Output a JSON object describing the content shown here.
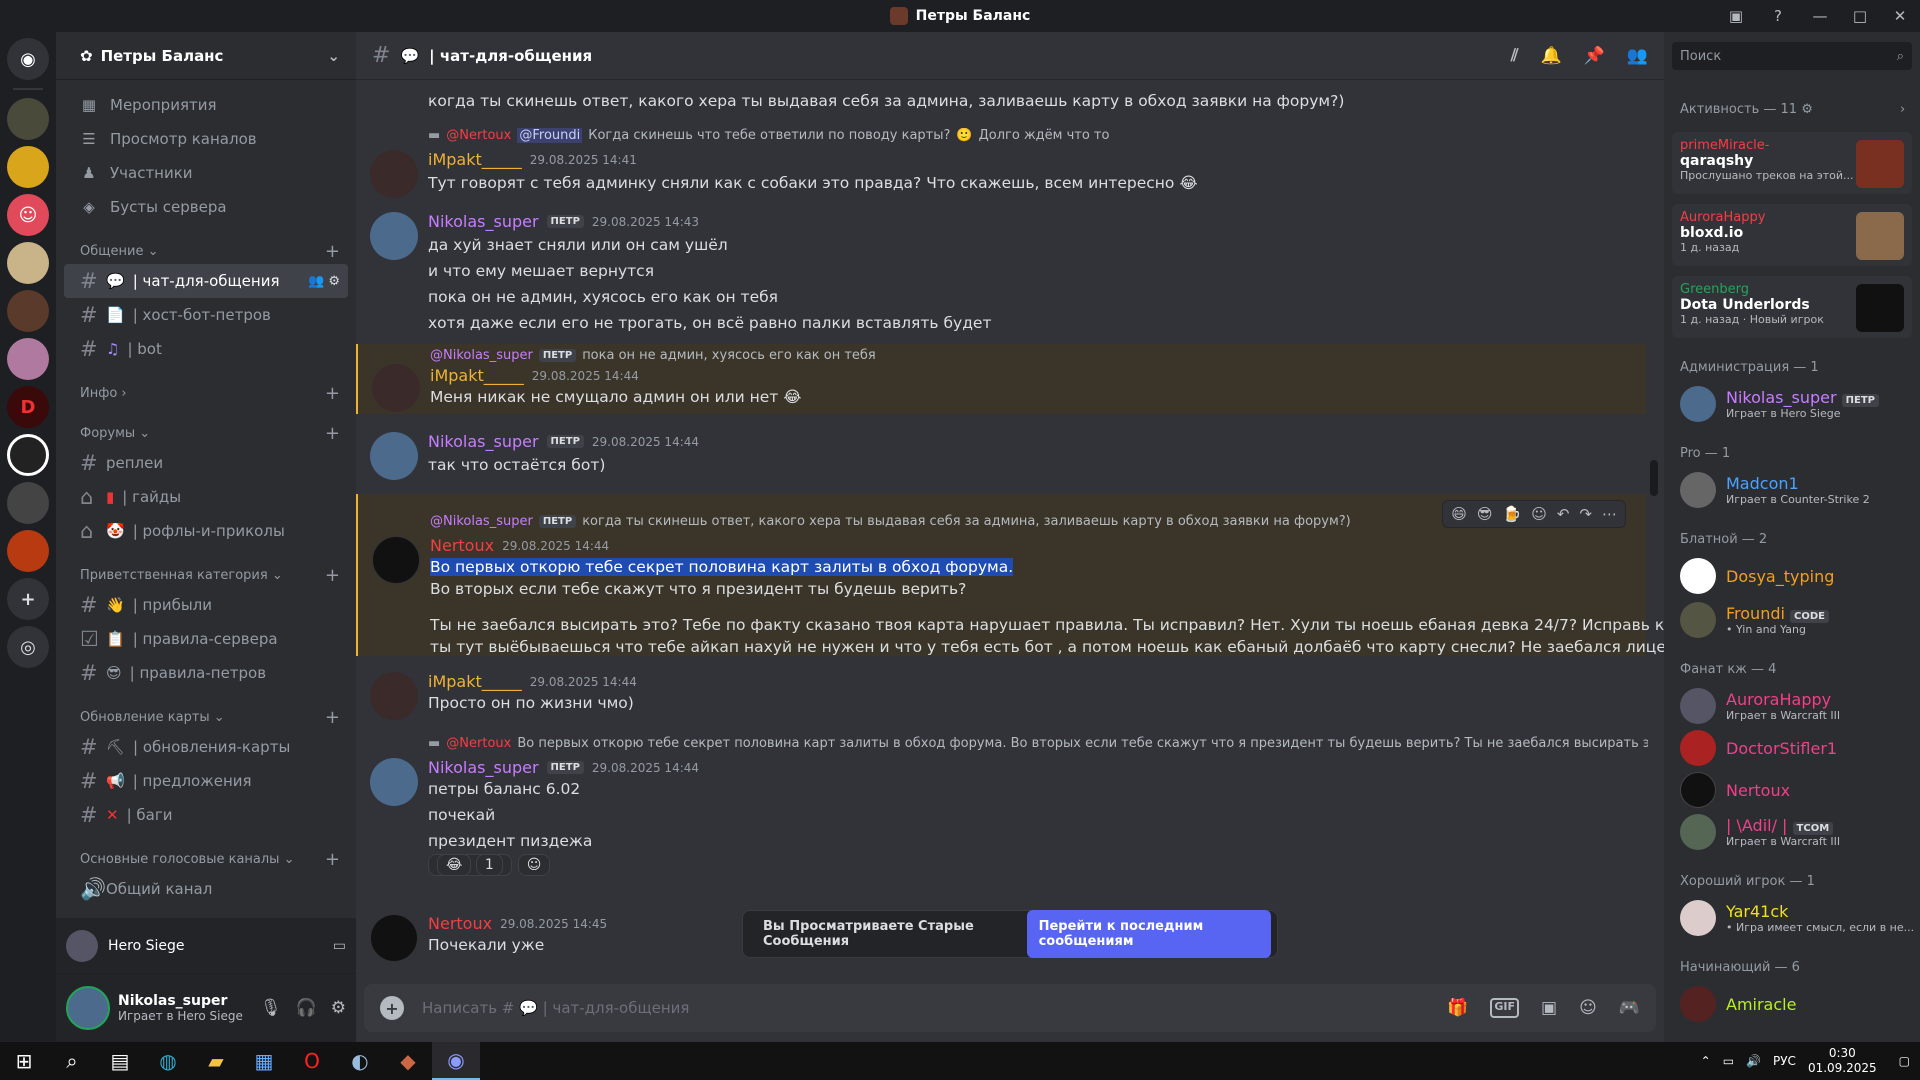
{
  "window": {
    "title": "Петры Баланс"
  },
  "server": {
    "name": "Петры Баланс"
  },
  "nav": [
    {
      "label": "Мероприятия",
      "icon": "calendar-icon"
    },
    {
      "label": "Просмотр каналов",
      "icon": "browse-icon"
    },
    {
      "label": "Участники",
      "icon": "members-icon"
    },
    {
      "label": "Бусты сервера",
      "icon": "boost-icon"
    }
  ],
  "categories": {
    "c1": "Общение",
    "c2": "Инфо",
    "c3": "Форумы",
    "c4": "Приветственная категория",
    "c5": "Обновление карты",
    "c6": "Основные голосовые каналы"
  },
  "channels": {
    "chat": "| чат-для-общения",
    "host": "| хост-бот-петров",
    "bot": "| bot",
    "replays": "реплеи",
    "guides": "| гайды",
    "jokes": "| рофлы-и-приколы",
    "arrivals": "| прибыли",
    "rules": "| правила-сервера",
    "rules2": "| правила-петров",
    "updates": "| обновления-карты",
    "suggest": "| предложения",
    "bugs": "| баги",
    "voice": "Общий канал"
  },
  "voice_activity": {
    "label": "Hero Siege"
  },
  "user": {
    "name": "Nikolas_super",
    "status": "Играет в Hero Siege"
  },
  "chat": {
    "channel_name": "| чат-для-общения",
    "composer_placeholder_a": "Написать #",
    "composer_placeholder_b": "| чат-для-общения",
    "old_messages": "Вы Просматриваете Старые Сообщения",
    "jump_label": "Перейти к последним сообщениям"
  },
  "messages": {
    "top_line": "когда ты скинешь ответ, какого хера ты выдавая себя за админа, заливаешь карту в обход заявки на форум?)",
    "m1": {
      "reply_author": "@Nertoux",
      "reply_mention": "@Froundi",
      "reply_text": "Когда скинешь что тебе ответили по поводу карты?",
      "reply_text2": "Долго ждём что то",
      "author": "iMpakt_____",
      "time": "29.08.2025 14:41",
      "line1": "Тут говорят с тебя админку сняли как с собаки это правда? Что скажешь, всем интересно"
    },
    "m2": {
      "author": "Nikolas_super",
      "tag": "ПЕТР",
      "time": "29.08.2025 14:43",
      "line1": "да хуй знает сняли или он сам ушёл",
      "line2": "и что ему мешает вернутся",
      "line3": "пока он не админ, хуясось его как он тебя",
      "line4": "хотя даже если его не трогать, он всё равно палки вставлять будет"
    },
    "m3": {
      "reply_author": "@Nikolas_super",
      "reply_tag": "ПЕТР",
      "reply_text": "пока он не админ, хуясось его как он тебя",
      "author": "iMpakt_____",
      "time": "29.08.2025 14:44",
      "line1": "Меня никак не смущало админ он или нет"
    },
    "m4": {
      "author": "Nikolas_super",
      "tag": "ПЕТР",
      "time": "29.08.2025 14:44",
      "line1": "так что остаётся бот)"
    },
    "m5": {
      "reply_author": "@Nikolas_super",
      "reply_tag": "ПЕТР",
      "reply_text": "когда ты скинешь ответ, какого хера ты выдавая себя за админа, заливаешь карту в обход заявки на форум?)",
      "author": "Nertoux",
      "time": "29.08.2025 14:44",
      "line1": "Во первых откорю тебе секрет половина карт залиты в обход форума.",
      "line2": "Во вторых если тебе скажут что я президент ты будешь верить?",
      "line3": "Ты не заебался высирать это? Тебе по факту сказано твоя карта нарушает правила. Ты исправил? Нет. Хули ты ноешь ебаная девка 24/7? Исправь карту и залей. Хули",
      "line4": "ты тут выёбываешься что тебе айкап нахуй не нужен и что у тебя есть бот , а потом ноешь как ебаный долбаёб что карту снесли? Не заебался лицемерить?"
    },
    "m6": {
      "author": "iMpakt_____",
      "time": "29.08.2025 14:44",
      "line1": "Просто он по жизни чмо)"
    },
    "m7": {
      "reply_author": "@Nertoux",
      "reply_text": "Во первых откорю тебе секрет половина карт залиты в обход форума.  Во вторых если тебе скажут что я президент ты будешь верить?  Ты не заебался высирать это? Тебе по фак...",
      "author": "Nikolas_super",
      "tag": "ПЕТР",
      "time": "29.08.2025 14:44",
      "line1": "петры баланс 6.02",
      "line2": "почекай",
      "line3": "президент пиздежа",
      "reaction_count": "1"
    },
    "m8": {
      "author": "Nertoux",
      "time": "29.08.2025 14:45",
      "line1": "Почекали уже"
    }
  },
  "members": {
    "search_placeholder": "Поиск",
    "activity_header": "Активность — 11",
    "activities": [
      {
        "name": "primeMiracle-",
        "game": "qaraqshy",
        "sub": "Прослушано треков на этой..."
      },
      {
        "name": "AuroraHappy",
        "game": "bloxd.io",
        "sub": "1 д. назад"
      },
      {
        "name": "Greenberg",
        "game": "Dota Underlords",
        "sub": "1 д. назад",
        "sub2": "Новый игрок"
      }
    ],
    "groups": {
      "g1": "Администрация — 1",
      "g2": "Pro — 1",
      "g3": "Блатной — 2",
      "g4": "Фанат кж — 4",
      "g5": "Хороший игрок — 1",
      "g6": "Начинающий — 6"
    },
    "list": {
      "nikolas": {
        "name": "Nikolas_super",
        "tag": "ПЕТР",
        "status": "Играет в Hero Siege"
      },
      "madcon": {
        "name": "Madcon1",
        "status": "Играет в Counter-Strike 2"
      },
      "dosya": {
        "name": "Dosya_typing"
      },
      "froundi": {
        "name": "Froundi",
        "tag": "CODE",
        "status": "• Yin and Yang"
      },
      "aurora": {
        "name": "AuroraHappy",
        "status": "Играет в Warcraft III"
      },
      "doctor": {
        "name": "DoctorStifler1"
      },
      "nertoux": {
        "name": "Nertoux"
      },
      "adil": {
        "name": "| \\Adil/ |",
        "tag": "TCOM",
        "status": "Играет в Warcraft III"
      },
      "yar": {
        "name": "Yar41ck",
        "status": "• Игра имеет смысл, если в не..."
      },
      "amiracle": {
        "name": "Amiracle"
      }
    }
  },
  "taskbar": {
    "lang": "РУС",
    "time": "0:30",
    "date": "01.09.2025"
  },
  "colors": {
    "accent": "#5865f2",
    "impakt": "#f0b232",
    "nikolas": "#c77dff",
    "nertoux": "#f23f43",
    "mention_bg": "#3a3528"
  }
}
